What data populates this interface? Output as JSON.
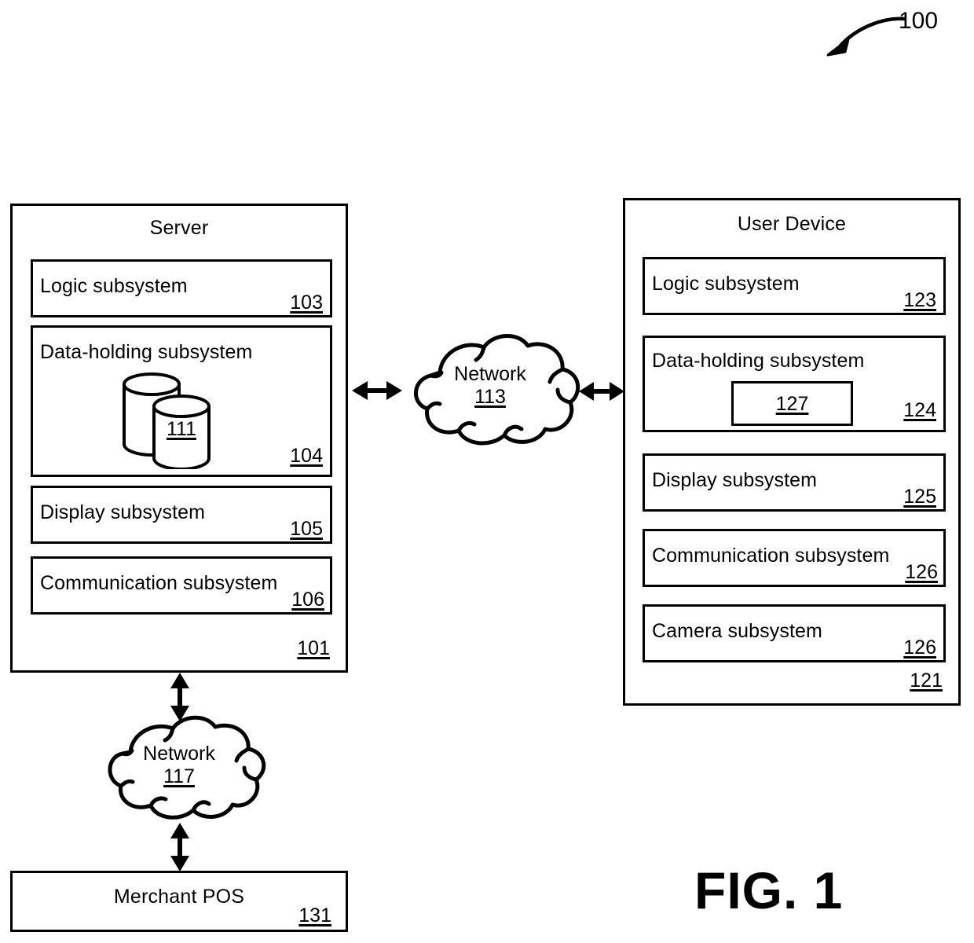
{
  "figure": {
    "caption": "FIG. 1",
    "system_ref": "100"
  },
  "server": {
    "title": "Server",
    "ref": "101",
    "subsystems": [
      {
        "label": "Logic subsystem",
        "ref": "103"
      },
      {
        "label": "Data-holding subsystem",
        "ref": "104",
        "db_ref": "111"
      },
      {
        "label": "Display subsystem",
        "ref": "105"
      },
      {
        "label": "Communication subsystem",
        "ref": "106"
      }
    ]
  },
  "user_device": {
    "title": "User Device",
    "ref": "121",
    "subsystems": [
      {
        "label": "Logic subsystem",
        "ref": "123"
      },
      {
        "label": "Data-holding subsystem",
        "ref": "124",
        "inner_ref": "127"
      },
      {
        "label": "Display subsystem",
        "ref": "125"
      },
      {
        "label": "Communication subsystem",
        "ref": "126"
      },
      {
        "label": "Camera subsystem",
        "ref": "126"
      }
    ]
  },
  "network_center": {
    "label": "Network",
    "ref": "113"
  },
  "network_lower": {
    "label": "Network",
    "ref": "117"
  },
  "merchant_pos": {
    "label": "Merchant POS",
    "ref": "131"
  },
  "icons": {
    "cylinder": "database-cylinder-icon",
    "cloud": "cloud-icon",
    "arrow_double": "double-headed-arrow-icon",
    "curved_arrow": "curved-leader-arrow-icon"
  },
  "colors": {
    "stroke": "#000000",
    "background": "#ffffff"
  }
}
